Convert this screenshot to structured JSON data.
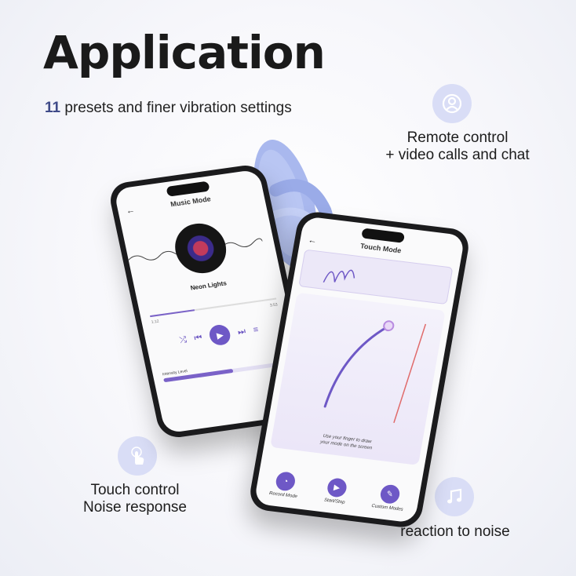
{
  "heading": {
    "title": "Application",
    "subtitle_number": "11",
    "subtitle_rest": " presets and finer vibration settings"
  },
  "features": {
    "remote": {
      "icon": "person-video-icon",
      "line1": "Remote control",
      "line2": "+ video calls and chat"
    },
    "touch": {
      "icon": "touch-hand-icon",
      "line1": "Touch control",
      "line2": "Noise response"
    },
    "noise": {
      "icon": "music-note-icon",
      "line1": "reaction to noise"
    }
  },
  "phone1": {
    "title": "Music Mode",
    "song": "Neon Lights",
    "time_start": "1:12",
    "time_end": "3:53",
    "volume_label": "Intensity Level",
    "volume_level": 0.55,
    "progress": 0.35
  },
  "phone2": {
    "title": "Touch Mode",
    "hint_line1": "Use your finger to draw",
    "hint_line2": "your mode on the screen",
    "modes": [
      {
        "label": "Record Mode",
        "icon": "record-icon"
      },
      {
        "label": "Start/Stop",
        "icon": "play-icon"
      },
      {
        "label": "Custom Modes",
        "icon": "custom-icon"
      }
    ]
  },
  "colors": {
    "accent": "#6e58c6",
    "icon_bg": "#d9ddf6",
    "device": "#a9b8ee",
    "subtitle_number": "#3f4a88"
  }
}
